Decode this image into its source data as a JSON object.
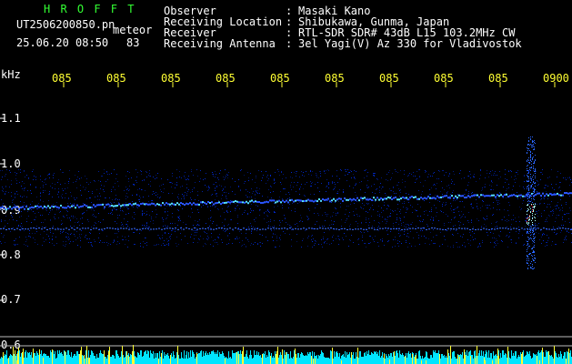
{
  "header": {
    "program": "H R O F F T",
    "filename": "UT2506200850.pn",
    "tag": "meteor",
    "datetime": "25.06.20 08:50",
    "count": "83",
    "fields": [
      {
        "label": "Observer",
        "value": "Masaki Kano"
      },
      {
        "label": "Receiving Location",
        "value": "Shibukawa, Gunma, Japan"
      },
      {
        "label": "Receiver",
        "value": "RTL-SDR SDR# 43dB L15 103.2MHz CW"
      },
      {
        "label": "Receiving Antenna",
        "value": "3el Yagi(V) Az 330 for Vladivostok"
      }
    ],
    "separator": ":"
  },
  "time_axis": {
    "labels": [
      "085",
      "085",
      "085",
      "085",
      "085",
      "085",
      "085",
      "085",
      "085",
      "0900"
    ]
  },
  "freq_axis": {
    "unit": "kHz",
    "labels": [
      "1.1",
      "1.0",
      "0.9",
      "0.8",
      "0.7",
      "0.6"
    ],
    "values": [
      1.1,
      1.0,
      0.9,
      0.8,
      0.7,
      0.6
    ]
  },
  "colors": {
    "background": "#000000",
    "text": "#ffffff",
    "title": "#33ff33",
    "time_labels": "#ffff33",
    "trace": "#2a4cff",
    "echo": "#66aaff"
  }
}
